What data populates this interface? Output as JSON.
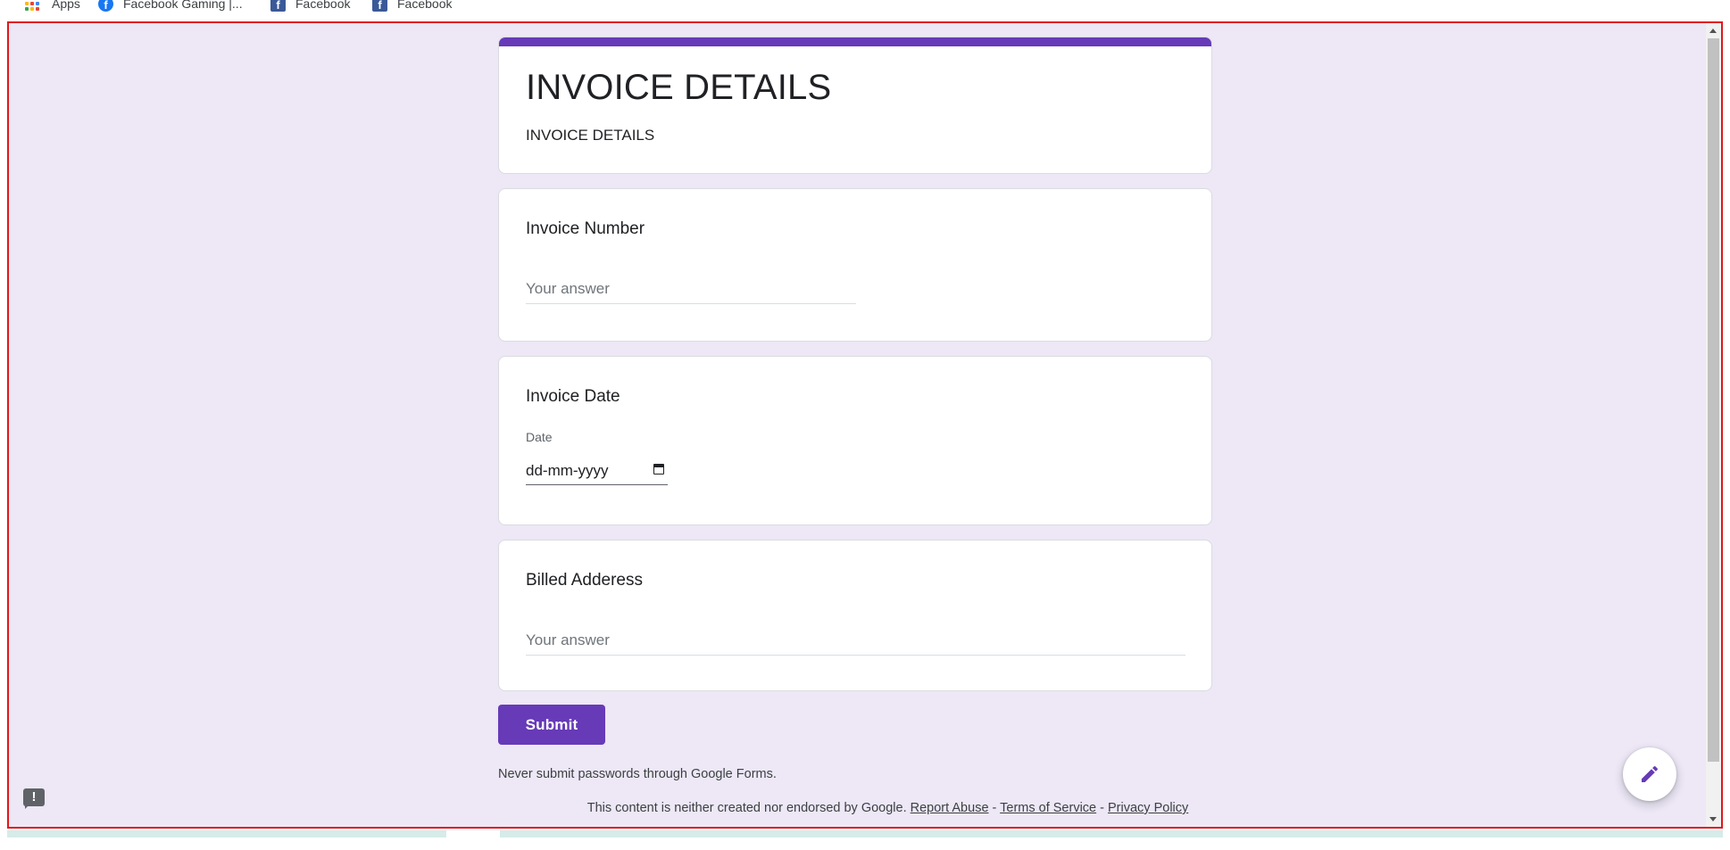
{
  "bookmarks": [
    {
      "label": "Apps",
      "icon": "apps-grid-icon"
    },
    {
      "label": "Facebook Gaming |...",
      "icon": "facebook-gaming-icon"
    },
    {
      "label": "Facebook",
      "icon": "facebook-icon"
    },
    {
      "label": "Facebook",
      "icon": "facebook-icon"
    }
  ],
  "form": {
    "title": "INVOICE DETAILS",
    "description": "INVOICE DETAILS",
    "accent_color": "#673ab7",
    "background_color": "#ede7f6",
    "questions": [
      {
        "title": "Invoice Number",
        "placeholder": "Your answer"
      },
      {
        "title": "Invoice Date",
        "sublabel": "Date",
        "date_placeholder": "dd-mm-yyyy"
      },
      {
        "title": "Billed Adderess",
        "placeholder": "Your answer"
      }
    ],
    "submit_label": "Submit",
    "password_note": "Never submit passwords through Google Forms."
  },
  "footer": {
    "text": "This content is neither created nor endorsed by Google.",
    "links": [
      "Report Abuse",
      "Terms of Service",
      "Privacy Policy"
    ],
    "separator": " - "
  },
  "icons": {
    "report": "report-problem-icon",
    "edit": "edit-pencil-icon"
  }
}
